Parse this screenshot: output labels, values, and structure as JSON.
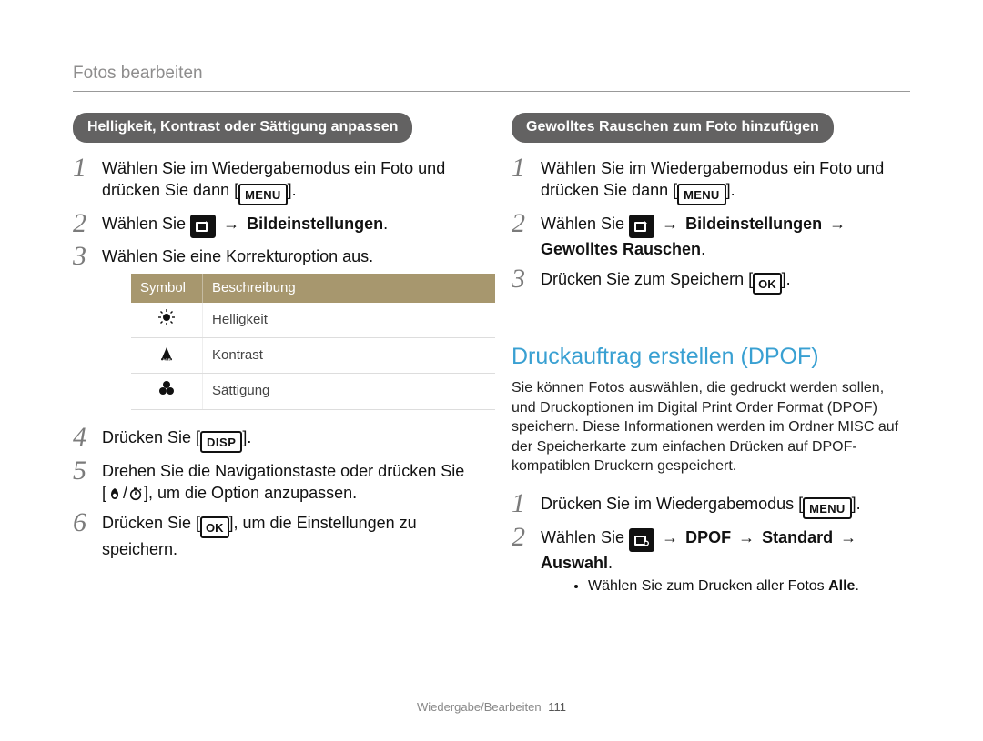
{
  "header": {
    "breadcrumb": "Fotos bearbeiten"
  },
  "footer": {
    "section": "Wiedergabe/Bearbeiten",
    "page": "111"
  },
  "icons": {
    "menu": "MENU",
    "ok": "OK",
    "disp": "DISP"
  },
  "left": {
    "pill": "Helligkeit, Kontrast oder Sättigung anpassen",
    "steps_text": {
      "s1a": "Wählen Sie im Wiedergabemodus ein Foto und drücken Sie dann [",
      "s1b": "].",
      "s2a": "Wählen Sie ",
      "s2arrow": " → ",
      "s2b": "Bildeinstellungen",
      "s2c": ".",
      "s3": "Wählen Sie eine Korrekturoption aus.",
      "s4a": "Drücken Sie [",
      "s4b": "].",
      "s5a": "Drehen Sie die Navigationstaste oder drücken Sie [",
      "s5slash": "/",
      "s5b": "], um die Option anzupassen.",
      "s6a": "Drücken Sie [",
      "s6b": "], um die Einstellungen zu speichern."
    },
    "table": {
      "headers": [
        "Symbol",
        "Beschreibung"
      ],
      "rows": [
        {
          "icon": "brightness",
          "label": "Helligkeit"
        },
        {
          "icon": "contrast",
          "label": "Kontrast"
        },
        {
          "icon": "saturation",
          "label": "Sättigung"
        }
      ]
    }
  },
  "right": {
    "pill": "Gewolltes Rauschen zum Foto hinzufügen",
    "steps_text": {
      "s1a": "Wählen Sie im Wiedergabemodus ein Foto und drücken Sie dann [",
      "s1b": "].",
      "s2a": "Wählen Sie ",
      "s2arrow1": " → ",
      "s2b": "Bildeinstellungen",
      "s2arrow2": " → ",
      "s2c": "Gewolltes Rauschen",
      "s2d": ".",
      "s3a": "Drücken Sie zum Speichern [",
      "s3b": "]."
    },
    "section_title": "Druckauftrag erstellen (DPOF)",
    "section_body": "Sie können Fotos auswählen, die gedruckt werden sollen, und Druckoptionen im Digital Print Order Format (DPOF) speichern. Diese Informationen werden im Ordner MISC auf der Speicherkarte zum einfachen Drücken auf DPOF-kompatiblen Druckern gespeichert.",
    "dpof_steps": {
      "s1a": "Drücken Sie im Wiedergabemodus [",
      "s1b": "].",
      "s2a": "Wählen Sie ",
      "s2arrow1": " → ",
      "s2b": "DPOF",
      "s2arrow2": " → ",
      "s2c": "Standard",
      "s2arrow3": " → ",
      "s2d": "Auswahl",
      "s2e": ".",
      "bullet_a": "Wählen Sie zum Drucken aller Fotos ",
      "bullet_b": "Alle",
      "bullet_c": "."
    }
  }
}
